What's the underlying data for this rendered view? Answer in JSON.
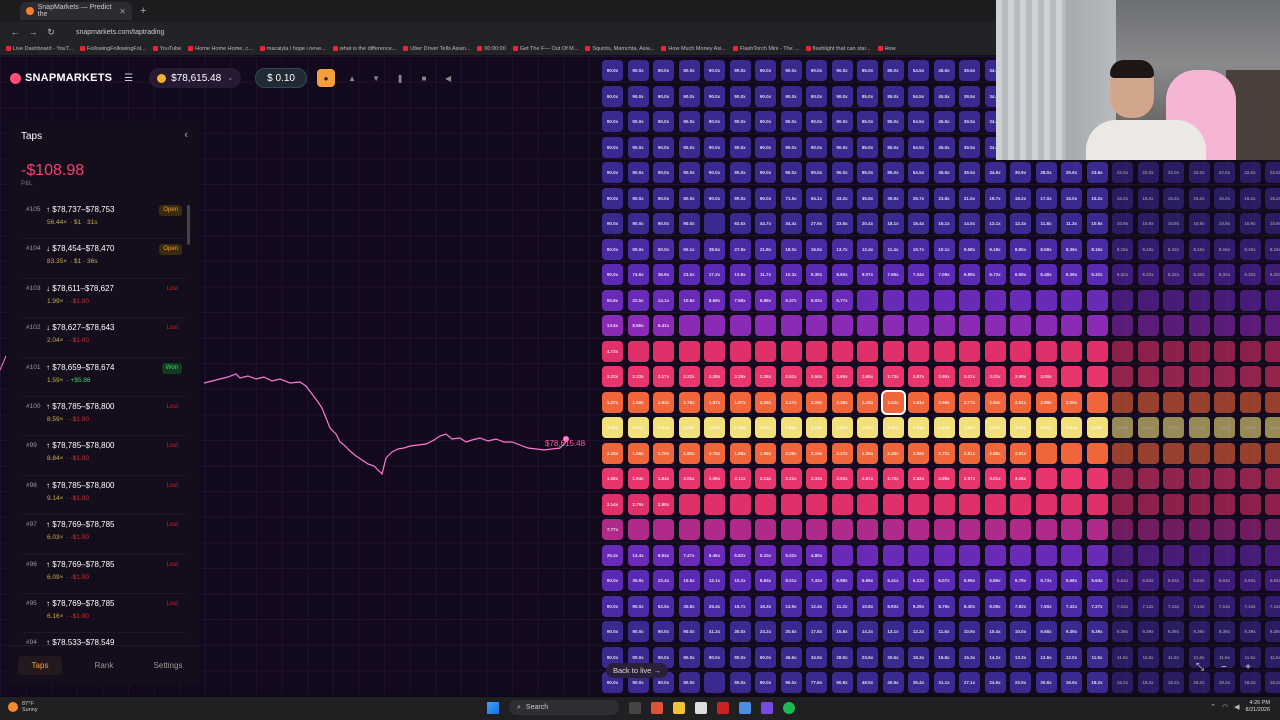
{
  "browser": {
    "tab_title": "SnapMarkets — Predict the",
    "url": "snapmarkets.com/taptrading",
    "bookmarks": [
      "Live Dashboard - YouT...",
      "FollowingFollowingFol...",
      "YouTube",
      "Home Home Home, c...",
      "macaiyla i hope i neve...",
      "what is the difference...",
      "Uber Driver Tells Asian...",
      "00:00:00",
      "Get The F— Out Of M...",
      "Squints, Mamchta, Asia...",
      "How Much Money Asi...",
      "FlashTorch Mini - The ...",
      "flashlight that can star...",
      "How"
    ]
  },
  "header": {
    "logo": "SNAPMARKETS",
    "balance": "$78,615.48",
    "stake": "$ 0.10"
  },
  "sidebar": {
    "title": "Taps",
    "pnl": "-$108.98",
    "pnl_label": "P&L",
    "trades": [
      {
        "id": "#105",
        "range": "↑ $78,737–$78,753",
        "mult": "56.44×",
        "detail": "· $1 · 31s",
        "status": "Open",
        "kind": "open"
      },
      {
        "id": "#104",
        "range": "↓ $78,454–$78,470",
        "mult": "83.35×",
        "detail": "· $1 · 36s",
        "status": "Open",
        "kind": "open"
      },
      {
        "id": "#103",
        "range": "↓ $78,611–$78,627",
        "mult": "1.99×",
        "detail": "· -$1.00",
        "status": "Lost",
        "kind": "lost"
      },
      {
        "id": "#102",
        "range": "↓ $78,627–$78,643",
        "mult": "2.04×",
        "detail": "· -$1.00",
        "status": "Lost",
        "kind": "lost"
      },
      {
        "id": "#101",
        "range": "↑ $78,659–$78,674",
        "mult": "1.59×",
        "detail": "· +$5.86",
        "status": "Won",
        "kind": "won"
      },
      {
        "id": "#100",
        "range": "↑ $78,785–$78,800",
        "mult": "8.59×",
        "detail": "· -$1.00",
        "status": "Lost",
        "kind": "lost"
      },
      {
        "id": "#99",
        "range": "↑ $78,785–$78,800",
        "mult": "8.84×",
        "detail": "· -$1.00",
        "status": "Lost",
        "kind": "lost"
      },
      {
        "id": "#98",
        "range": "↑ $78,785–$78,800",
        "mult": "9.14×",
        "detail": "· -$1.00",
        "status": "Lost",
        "kind": "lost"
      },
      {
        "id": "#97",
        "range": "↑ $78,769–$78,785",
        "mult": "6.03×",
        "detail": "· -$1.00",
        "status": "Lost",
        "kind": "lost"
      },
      {
        "id": "#96",
        "range": "↑ $78,769–$78,785",
        "mult": "6.09×",
        "detail": "· -$1.00",
        "status": "Lost",
        "kind": "lost"
      },
      {
        "id": "#95",
        "range": "↑ $78,769–$78,785",
        "mult": "6.16×",
        "detail": "· -$1.00",
        "status": "Lost",
        "kind": "lost"
      },
      {
        "id": "#94",
        "range": "↑ $78,533–$78,549",
        "mult": "",
        "detail": "",
        "status": "",
        "kind": "lost"
      }
    ],
    "footer_tabs": [
      "Taps",
      "Rank",
      "Settings"
    ]
  },
  "chart": {
    "current_price": "$78,615.48"
  },
  "grid": {
    "back_to_live": "Back to live →",
    "rows": [
      {
        "vals": [
          "90.0x",
          "90.0x",
          "90.0x",
          "90.0x",
          "90.0x",
          "90.0x",
          "90.0x",
          "90.0x",
          "90.0x",
          "90.0x",
          "85.0x",
          "85.0x",
          "54.5x",
          "45.5x",
          "39.5x",
          "34.6x",
          "30.9x"
        ],
        "color": "#3a2a8f"
      },
      {
        "vals": [
          "90.0x",
          "90.0x",
          "90.0x",
          "90.0x",
          "90.0x",
          "90.0x",
          "90.0x",
          "90.0x",
          "90.0x",
          "90.0x",
          "85.0x",
          "85.0x",
          "54.5x",
          "45.5x",
          "39.5x",
          "34.6x",
          "30.9x"
        ],
        "color": "#3a2a8f"
      },
      {
        "vals": [
          "90.0x",
          "90.0x",
          "90.0x",
          "90.0x",
          "90.0x",
          "90.0x",
          "90.0x",
          "90.0x",
          "90.0x",
          "90.0x",
          "85.0x",
          "85.0x",
          "54.5x",
          "45.5x",
          "39.5x",
          "34.6x",
          "30.9x"
        ],
        "color": "#3a2a8f"
      },
      {
        "vals": [
          "90.0x",
          "90.0x",
          "90.0x",
          "90.0x",
          "90.0x",
          "90.0x",
          "90.0x",
          "90.0x",
          "90.0x",
          "90.0x",
          "85.0x",
          "85.0x",
          "54.5x",
          "45.5x",
          "39.5x",
          "34.6x",
          "30.9x"
        ],
        "color": "#3a2a8f"
      },
      {
        "vals": [
          "90.0x",
          "90.0x",
          "90.0x",
          "90.0x",
          "90.0x",
          "90.0x",
          "90.0x",
          "90.0x",
          "90.0x",
          "90.0x",
          "85.0x",
          "85.0x",
          "54.5x",
          "45.5x",
          "39.5x",
          "34.6x",
          "30.9x",
          "28.0x",
          "25.6x",
          "23.6x",
          "22.0x",
          "22.0x",
          "22.0x",
          "22.0x",
          "22.0x",
          "22.0x",
          "22.0x"
        ],
        "color": "#3a2a8f"
      },
      {
        "vals": [
          "90.0x",
          "90.0x",
          "90.0x",
          "90.0x",
          "90.0x",
          "90.0x",
          "90.0x",
          "71.5x",
          "54.1x",
          "43.2x",
          "35.8x",
          "30.5x",
          "26.7x",
          "23.8x",
          "21.5x",
          "19.7x",
          "18.2x",
          "17.0x",
          "16.0x",
          "15.2x",
          "15.2x",
          "15.2x",
          "15.2x",
          "15.2x",
          "15.2x",
          "15.2x",
          "15.2x"
        ],
        "color": "#3a2a8f"
      },
      {
        "vals": [
          "90.0x",
          "90.0x",
          "90.0x",
          "90.0x",
          "",
          "62.5x",
          "44.7x",
          "34.4x",
          "27.9x",
          "23.5x",
          "20.4x",
          "18.1x",
          "16.4x",
          "15.1x",
          "14.0x",
          "13.1x",
          "12.4x",
          "11.8x",
          "11.3x",
          "10.9x",
          "10.9x",
          "10.9x",
          "10.9x",
          "10.9x",
          "10.9x",
          "10.9x",
          "10.9x"
        ],
        "color": "#3a2a8f"
      },
      {
        "vals": [
          "90.0x",
          "90.0x",
          "90.0x",
          "60.1x",
          "38.6x",
          "27.9x",
          "21.8x",
          "18.0x",
          "15.5x",
          "13.7x",
          "12.4x",
          "11.4x",
          "10.7x",
          "10.1x",
          "9.58x",
          "9.18x",
          "8.85x",
          "8.58x",
          "8.36x",
          "8.15x",
          "8.15x",
          "8.15x",
          "8.15x",
          "8.15x",
          "8.15x",
          "8.15x",
          "8.15x"
        ],
        "color": "#4a2aa5"
      },
      {
        "vals": [
          "90.0x",
          "74.6x",
          "36.9x",
          "23.5x",
          "17.2x",
          "13.8x",
          "11.7x",
          "10.3x",
          "9.30x",
          "8.60x",
          "8.07x",
          "7.66x",
          "7.34x",
          "7.09x",
          "6.89x",
          "6.72x",
          "6.59x",
          "6.48x",
          "6.39x",
          "6.32x",
          "6.32x",
          "6.32x",
          "6.32x",
          "6.32x",
          "6.32x",
          "6.32x",
          "6.32x"
        ],
        "color": "#5a2ab5"
      },
      {
        "vals": [
          "50.8x",
          "22.5x",
          "14.1x",
          "10.6x",
          "8.69x",
          "7.58x",
          "6.86x",
          "6.37x",
          "6.02x",
          "5.77x",
          "",
          "",
          "",
          "",
          "",
          "",
          "",
          "",
          "",
          "",
          "",
          "",
          "",
          "",
          "",
          "",
          ""
        ],
        "color": "#6a2ab8"
      },
      {
        "vals": [
          "13.6x",
          "8.56x",
          "6.41x",
          "",
          "",
          "",
          "",
          "",
          "",
          "",
          "",
          "",
          "",
          "",
          "",
          "",
          "",
          "",
          "",
          "",
          "",
          "",
          "",
          "",
          "",
          "",
          ""
        ],
        "color": "#8a2ab5"
      },
      {
        "vals": [
          "4.72x",
          "",
          "",
          "",
          "",
          "",
          "",
          "",
          "",
          "",
          "",
          "",
          "",
          "",
          "",
          "",
          "",
          "",
          "",
          "",
          "",
          "",
          "",
          "",
          "",
          "",
          ""
        ],
        "color": "#e0306a"
      },
      {
        "vals": [
          "2.22x",
          "2.23x",
          "2.17x",
          "2.22x",
          "2.28x",
          "2.29x",
          "2.38x",
          "2.51x",
          "2.54x",
          "2.60x",
          "2.65x",
          "2.73x",
          "2.87x",
          "2.90x",
          "3.01x",
          "3.01x",
          "2.99x",
          "3.00x",
          "",
          "",
          "",
          "",
          "",
          "",
          "",
          "",
          ""
        ],
        "color": "#e8356e"
      },
      {
        "vals": [
          "1.37x",
          "1.50x",
          "1.63x",
          "1.75x",
          "1.87x",
          "1.97x",
          "2.08x",
          "2.17x",
          "2.29x",
          "2.38x",
          "2.48x",
          "2.53x",
          "2.61x",
          "2.69x",
          "2.77x",
          "2.84x",
          "2.91x",
          "2.99x",
          "3.06x",
          "",
          "",
          "",
          "",
          "",
          "",
          "",
          ""
        ],
        "color": "#f0663a"
      },
      {
        "vals": [
          "1.01x",
          "1.01x",
          "1.01x",
          "1.01x",
          "1.01x",
          "1.01x",
          "1.01x",
          "1.01x",
          "1.01x",
          "1.01x",
          "1.01x",
          "1.01x",
          "1.01x",
          "1.01x",
          "1.01x",
          "1.01x",
          "1.01x",
          "1.01x",
          "1.01x",
          "1.01x",
          "1.01x",
          "1.01x",
          "1.01x",
          "1.01x",
          "1.01x",
          "1.01x",
          "1.01x"
        ],
        "color": "#f2e07a"
      },
      {
        "vals": [
          "1.19x",
          "1.56x",
          "1.70x",
          "1.80x",
          "1.76x",
          "1.88x",
          "1.96x",
          "2.09x",
          "2.19x",
          "2.27x",
          "2.36x",
          "2.45x",
          "2.56x",
          "2.72x",
          "2.81x",
          "2.85x",
          "2.91x",
          "",
          "",
          "",
          "",
          "",
          "",
          "",
          "",
          "",
          ""
        ],
        "color": "#f0663a"
      },
      {
        "vals": [
          "1.68x",
          "1.94x",
          "1.84x",
          "2.01x",
          "2.06x",
          "2.11x",
          "2.14x",
          "2.21x",
          "2.33x",
          "2.52x",
          "2.61x",
          "2.73x",
          "2.82x",
          "2.89x",
          "2.97x",
          "3.01x",
          "3.06x",
          "",
          "",
          "",
          "",
          "",
          "",
          "",
          "",
          "",
          ""
        ],
        "color": "#e8356e"
      },
      {
        "vals": [
          "2.14x",
          "2.79x",
          "2.95x",
          "",
          "",
          "",
          "",
          "",
          "",
          "",
          "",
          "",
          "",
          "",
          "",
          "",
          "",
          "",
          "",
          "",
          "",
          "",
          "",
          "",
          "",
          "",
          ""
        ],
        "color": "#e0306a"
      },
      {
        "vals": [
          "7.77x",
          "",
          "",
          "",
          "",
          "",
          "",
          "",
          "",
          "",
          "",
          "",
          "",
          "",
          "",
          "",
          "",
          "",
          "",
          "",
          "",
          "",
          "",
          "",
          "",
          "",
          ""
        ],
        "color": "#b02a8a"
      },
      {
        "vals": [
          "25.4x",
          "13.4x",
          "9.54x",
          "7.47x",
          "6.46x",
          "5.82x",
          "5.33x",
          "5.02x",
          "4.80x",
          "",
          "",
          "",
          "",
          "",
          "",
          "",
          "",
          "",
          "",
          "",
          "",
          "",
          "",
          "",
          "",
          "",
          ""
        ],
        "color": "#6a2ab8"
      },
      {
        "vals": [
          "90.0x",
          "35.9x",
          "22.4x",
          "15.5x",
          "12.1x",
          "10.1x",
          "8.84x",
          "8.01x",
          "7.42x",
          "6.98x",
          "6.66x",
          "6.41x",
          "6.22x",
          "6.07x",
          "5.95x",
          "5.86x",
          "5.78x",
          "5.73x",
          "5.68x",
          "5.64x",
          "5.64x",
          "5.64x",
          "5.64x",
          "5.64x",
          "5.64x",
          "5.64x",
          "5.64x"
        ],
        "color": "#5a2ab5"
      },
      {
        "vals": [
          "90.0x",
          "90.0x",
          "63.5x",
          "35.8x",
          "25.4x",
          "19.7x",
          "16.3x",
          "13.9x",
          "12.4x",
          "11.2x",
          "10.8x",
          "9.93x",
          "9.29x",
          "8.79x",
          "8.40x",
          "8.08x",
          "7.82x",
          "7.60x",
          "7.42x",
          "7.27x",
          "7.14x",
          "7.14x",
          "7.14x",
          "7.14x",
          "7.14x",
          "7.14x",
          "7.14x"
        ],
        "color": "#4a2aa5"
      },
      {
        "vals": [
          "90.0x",
          "90.0x",
          "90.0x",
          "90.0x",
          "41.2x",
          "30.0x",
          "24.2x",
          "20.6x",
          "17.8x",
          "15.8x",
          "14.2x",
          "13.1x",
          "12.2x",
          "11.5x",
          "10.9x",
          "10.4x",
          "10.0x",
          "9.68x",
          "9.39x",
          "9.39x",
          "9.39x",
          "9.39x",
          "9.39x",
          "9.39x",
          "9.39x",
          "9.39x",
          "9.39x"
        ],
        "color": "#3a2a8f"
      },
      {
        "vals": [
          "90.0x",
          "90.0x",
          "90.0x",
          "90.0x",
          "90.0x",
          "90.0x",
          "90.0x",
          "46.5x",
          "34.9x",
          "28.0x",
          "23.6x",
          "20.5x",
          "18.3x",
          "16.6x",
          "15.3x",
          "14.2x",
          "13.3x",
          "12.6x",
          "12.0x",
          "11.5x",
          "11.5x",
          "11.5x",
          "11.5x",
          "11.5x",
          "11.5x",
          "11.5x",
          "11.5x"
        ],
        "color": "#3a2a8f"
      },
      {
        "vals": [
          "90.0x",
          "90.0x",
          "90.0x",
          "90.0x",
          "",
          "90.0x",
          "90.0x",
          "90.0x",
          "77.6x",
          "60.8x",
          "48.5x",
          "40.5x",
          "35.4x",
          "31.1x",
          "27.1x",
          "24.5x",
          "22.5x",
          "20.8x",
          "19.6x",
          "18.2x",
          "18.2x",
          "18.2x",
          "18.2x",
          "18.2x",
          "18.2x",
          "18.2x",
          "18.2x"
        ],
        "color": "#3a2a8f"
      }
    ]
  },
  "taskbar": {
    "temp": "87°F",
    "weather": "Sunny",
    "search": "Search",
    "time": "4:26 PM",
    "date": "8/21/2026"
  }
}
